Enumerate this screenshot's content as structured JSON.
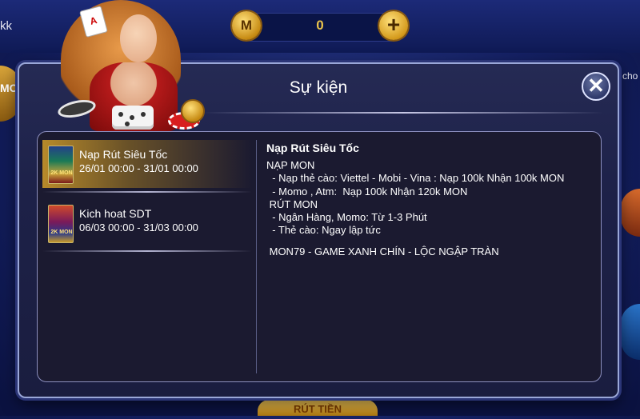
{
  "topbar": {
    "username_partial": "kk",
    "coin_symbol": "M",
    "balance": "0",
    "add_label": "+"
  },
  "background": {
    "left_tile_text": "MO",
    "right_text": "cho",
    "bottom_button": "RÚT TIỀN"
  },
  "modal": {
    "title": "Sự kiện",
    "close_label": "✕",
    "events": [
      {
        "title": "Nạp Rút Siêu Tốc",
        "date": "26/01 00:00 - 31/01 00:00",
        "thumb_text": "2K MON"
      },
      {
        "title": "Kich hoat SDT",
        "date": "06/03 00:00 - 31/03 00:00",
        "thumb_text": "2K MON"
      }
    ],
    "detail": {
      "title": "Nạp Rút Siêu Tốc",
      "lines": [
        "NẠP MON",
        "  - Nạp thẻ cào: Viettel - Mobi - Vina : Nạp 100k Nhận 100k MON",
        "  - Momo , Atm:  Nạp 100k Nhận 120k MON",
        " RÚT MON",
        "  - Ngân Hàng, Momo: Từ 1-3 Phút",
        "  - Thẻ cào: Ngay lập tức"
      ],
      "footer": " MON79 - GAME XANH CHÍN - LỘC NGẬP TRÀN"
    }
  }
}
